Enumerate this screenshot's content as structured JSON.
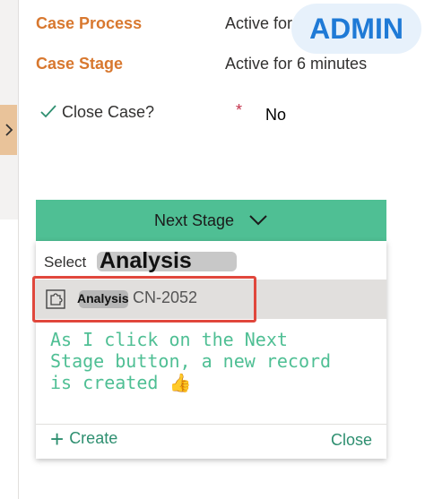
{
  "form": {
    "case_process_label": "Case Process",
    "case_process_value": "Active for",
    "case_stage_label": "Case Stage",
    "case_stage_value": "Active for 6 minutes",
    "close_case_label": "Close Case?",
    "required_marker": "*",
    "close_case_value": "No"
  },
  "badge": {
    "text": "ADMIN"
  },
  "next_stage": {
    "label": "Next Stage"
  },
  "dropdown": {
    "select_label": "Select",
    "select_entity": "Analysis",
    "result": {
      "entity": "Analysis",
      "name": "CN-2052"
    },
    "create_label": "Create",
    "close_label": "Close"
  },
  "annotation": {
    "text": "As I click on the Next\nStage button, a new record\nis created 👍"
  },
  "colors": {
    "accent": "#4fbf94",
    "label_orange": "#d8782f",
    "link_green": "#2e8f70",
    "highlight_red": "#e0473c",
    "badge_blue": "#1f7ad6"
  },
  "icons": [
    "chevron-right-icon",
    "checkmark-icon",
    "chevron-down-icon",
    "puzzle-icon",
    "plus-icon"
  ]
}
